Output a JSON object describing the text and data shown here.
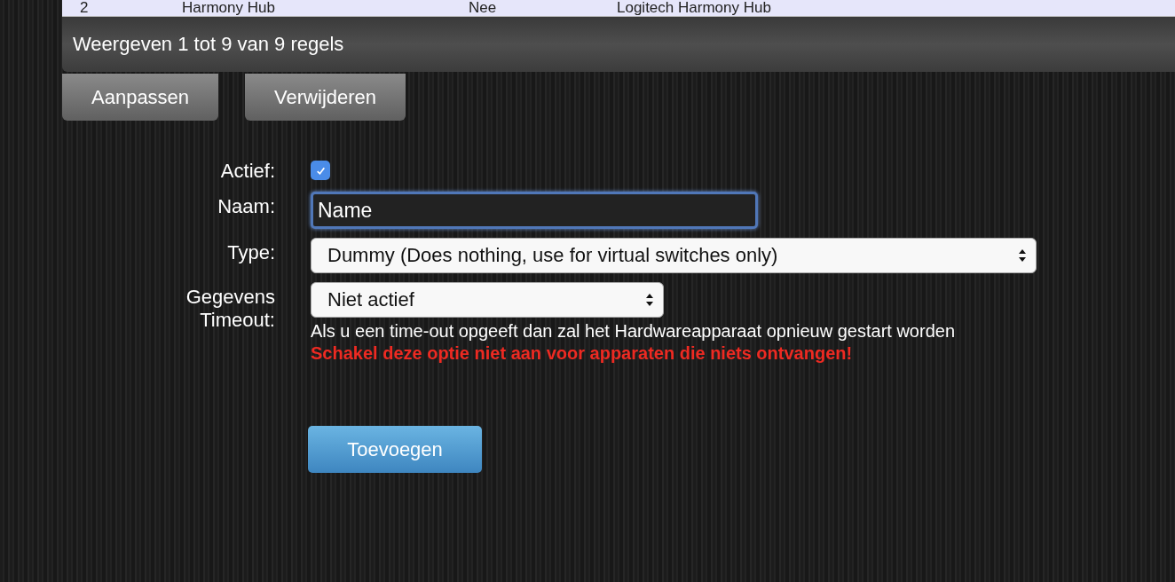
{
  "table": {
    "rows": [
      {
        "column_1": "2",
        "column_2": "Harmony Hub",
        "column_3": "Nee",
        "column_4": "Logitech Harmony Hub"
      }
    ],
    "footer": "Weergeven 1 tot 9 van 9 regels"
  },
  "actions": [
    "Aanpassen",
    "Verwijderen"
  ],
  "form": {
    "active": {
      "label": "Actief:",
      "checked": true
    },
    "name": {
      "label": "Naam:",
      "value": "Name"
    },
    "type": {
      "label": "Type:",
      "value": "Dummy (Does nothing, use for virtual switches only)"
    },
    "timeout": {
      "label": "Gegevens Timeout:",
      "value": "Niet actief",
      "hint": "Als u een time-out opgeeft dan zal het Hardwareapparaat opnieuw gestart worden",
      "warning": "Schakel deze optie niet aan voor apparaten die niets ontvangen!"
    },
    "submit": "Toevoegen"
  }
}
